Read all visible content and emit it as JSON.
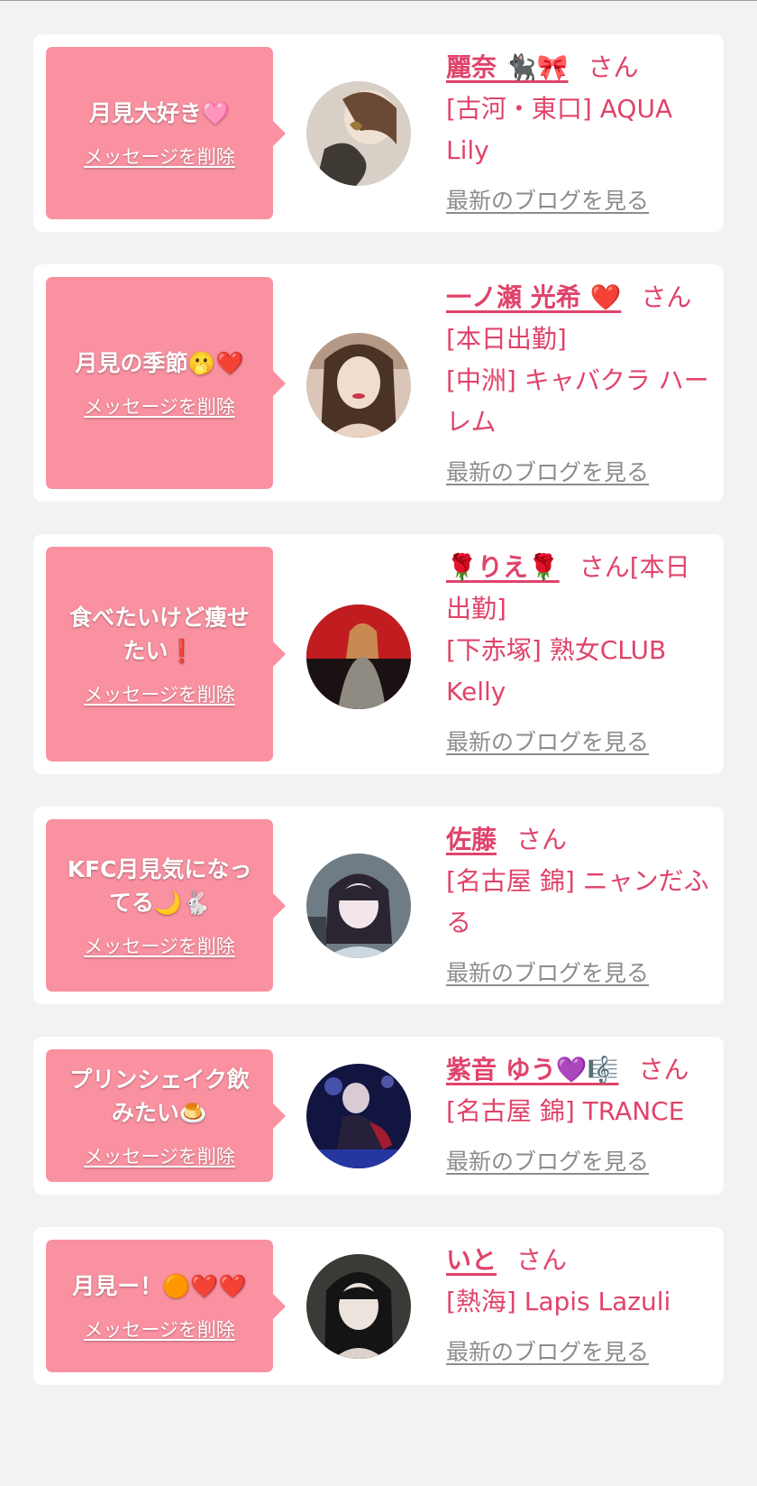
{
  "cards": [
    {
      "message": "月見大好き🩷",
      "delete_label": "メッセージを削除",
      "name": "麗奈 🐈‍⬛🎀",
      "honorific": "さん",
      "details": [
        "[古河・東口] AQUA Lily"
      ],
      "blog_label": "最新のブログを見る"
    },
    {
      "message": "月見の季節🫢❤️",
      "delete_label": "メッセージを削除",
      "name": "一ノ瀬 光希 ❤️",
      "honorific": "さん",
      "details": [
        "[本日出勤]",
        "[中洲] キャバクラ ハーレム"
      ],
      "blog_label": "最新のブログを見る"
    },
    {
      "message": "食べたいけど痩せたい❗️",
      "delete_label": "メッセージを削除",
      "name": "🌹りえ🌹",
      "honorific": "さん[本日出勤]",
      "details": [
        "[下赤塚] 熟女CLUB Kelly"
      ],
      "blog_label": "最新のブログを見る"
    },
    {
      "message": "KFC月見気になってる🌙🐇",
      "delete_label": "メッセージを削除",
      "name": "佐藤",
      "honorific": "さん",
      "details": [
        "[名古屋 錦] ニャンだふる"
      ],
      "blog_label": "最新のブログを見る"
    },
    {
      "message": "プリンシェイク飲みたい🍮",
      "delete_label": "メッセージを削除",
      "name": "紫音 ゆう💜🎼",
      "honorific": "さん",
      "details": [
        "[名古屋 錦] TRANCE"
      ],
      "blog_label": "最新のブログを見る"
    },
    {
      "message": "月見ー！🟠❤️❤️",
      "delete_label": "メッセージを削除",
      "name": "いと",
      "honorific": "さん",
      "details": [
        "[熱海] Lapis Lazuli"
      ],
      "blog_label": "最新のブログを見る"
    }
  ],
  "colors": {
    "page_background": "#f2f2f2",
    "card_background": "#ffffff",
    "bubble": "#f991a1",
    "name_text": "#e0436a",
    "blog_link": "#8c8c8c"
  }
}
